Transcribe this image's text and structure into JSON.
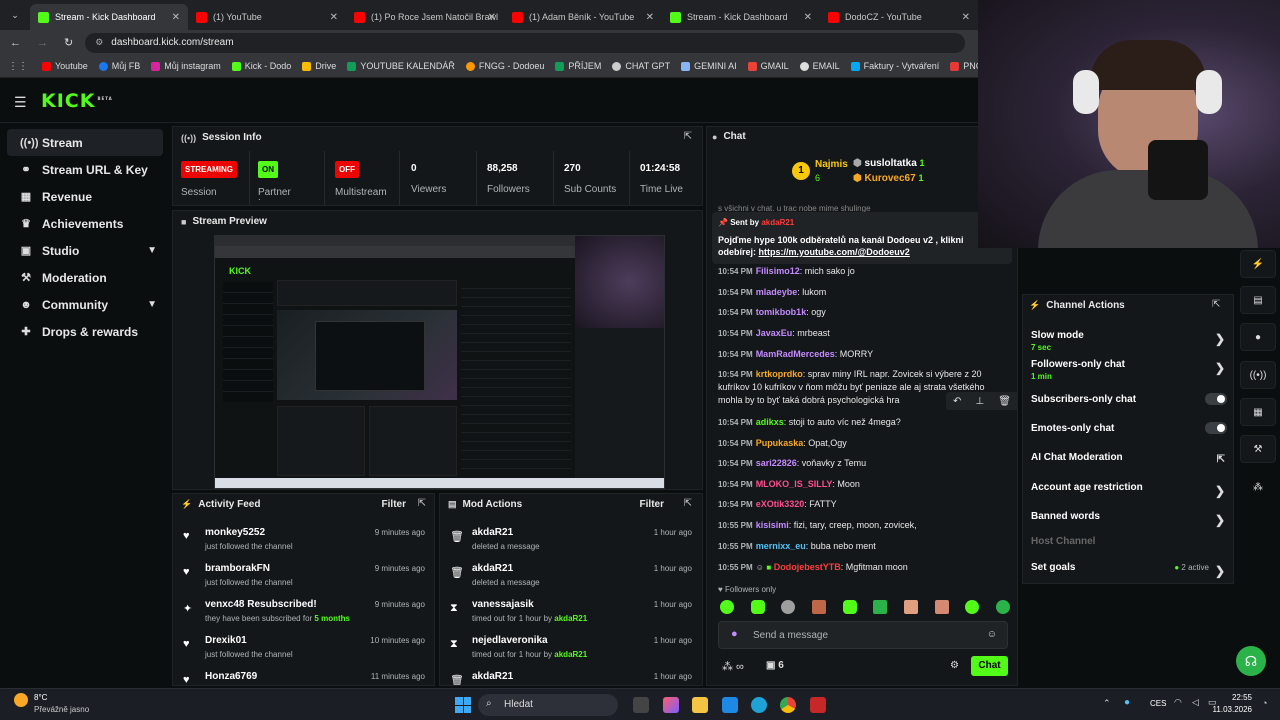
{
  "browser": {
    "tabs": [
      {
        "title": "Stream - Kick Dashboard",
        "icon": "kick",
        "active": true
      },
      {
        "title": "(1) YouTube",
        "icon": "youtube"
      },
      {
        "title": "(1) Po Roce Jsem Natočil Brawl",
        "icon": "youtube"
      },
      {
        "title": "(1) Adam Běník - YouTube",
        "icon": "youtube"
      },
      {
        "title": "Stream - Kick Dashboard",
        "icon": "kick"
      },
      {
        "title": "DodoCZ - YouTube",
        "icon": "youtube"
      }
    ],
    "url": "dashboard.kick.com/stream",
    "bookmarks": [
      "Youtube",
      "Můj FB",
      "Můj instagram",
      "Kick - Dodo",
      "Drive",
      "YOUTUBE KALENDÁŘ",
      "FNGG - Dodoeu",
      "PŘÍJEM",
      "CHAT GPT",
      "GEMINI AI",
      "GMAIL",
      "EMAIL",
      "Faktury - Vytváření",
      "PNG to PDF"
    ]
  },
  "header": {
    "logo": "KICK",
    "beta": "BETA"
  },
  "sidebar": {
    "items": [
      {
        "label": "Stream",
        "icon": "signal-icon",
        "active": true
      },
      {
        "label": "Stream URL & Key",
        "icon": "link-icon"
      },
      {
        "label": "Revenue",
        "icon": "revenue-icon"
      },
      {
        "label": "Achievements",
        "icon": "trophy-icon"
      },
      {
        "label": "Studio",
        "icon": "studio-icon",
        "chevron": true
      },
      {
        "label": "Moderation",
        "icon": "wrench-icon"
      },
      {
        "label": "Community",
        "icon": "people-icon",
        "chevron": true
      },
      {
        "label": "Drops & rewards",
        "icon": "gift-icon"
      }
    ]
  },
  "session": {
    "title": "Session Info",
    "stats": [
      {
        "badge": "STREAMING",
        "badge_color": "#eb0400",
        "label": "Session"
      },
      {
        "badge": "ON",
        "badge_color": "#53fc18",
        "label": "Partner Income"
      },
      {
        "badge": "OFF",
        "badge_color": "#eb0400",
        "label": "Multistream"
      },
      {
        "value": "0",
        "label": "Viewers"
      },
      {
        "value": "88,258",
        "label": "Followers"
      },
      {
        "value": "270",
        "label": "Sub Counts"
      },
      {
        "value": "01:24:58",
        "label": "Time Live"
      }
    ]
  },
  "preview": {
    "title": "Stream Preview"
  },
  "activity": {
    "title": "Activity Feed",
    "filter": "Filter",
    "items": [
      {
        "name": "monkey5252",
        "sub": "just followed the channel",
        "time": "9 minutes ago",
        "icon": "heart-icon"
      },
      {
        "name": "bramborakFN",
        "sub": "just followed the channel",
        "time": "9 minutes ago",
        "icon": "heart-icon"
      },
      {
        "name": "venxc48 Resubscribed!",
        "sub": "they have been subscribed for",
        "sub_em": "5 months",
        "time": "9 minutes ago",
        "icon": "sparkle-icon"
      },
      {
        "name": "Drexik01",
        "sub": "just followed the channel",
        "time": "10 minutes ago",
        "icon": "heart-icon"
      },
      {
        "name": "Honza6769",
        "sub": "",
        "time": "11 minutes ago",
        "icon": "heart-icon"
      }
    ]
  },
  "mod": {
    "title": "Mod Actions",
    "filter": "Filter",
    "items": [
      {
        "name": "akdaR21",
        "sub": "deleted a message",
        "time": "1 hour ago",
        "icon": "trash-icon"
      },
      {
        "name": "akdaR21",
        "sub": "deleted a message",
        "time": "1 hour ago",
        "icon": "trash-icon"
      },
      {
        "name": "vanessajasik",
        "sub": "timed out for 1 hour by",
        "by": "akdaR21",
        "time": "1 hour ago",
        "icon": "hourglass-icon"
      },
      {
        "name": "nejedlaveronika",
        "sub": "timed out for 1 hour by",
        "by": "akdaR21",
        "time": "1 hour ago",
        "icon": "hourglass-icon"
      },
      {
        "name": "akdaR21",
        "sub": "",
        "time": "1 hour ago",
        "icon": "trash-icon"
      }
    ]
  },
  "chat": {
    "title": "Chat",
    "gifters": [
      {
        "rank": "1",
        "name": "Najmis",
        "count": "6"
      },
      {
        "name": "susloltatka",
        "count": "1"
      },
      {
        "name": "Kurovec67",
        "count": "1"
      }
    ],
    "pinned_top": "s všichni v chat. u trac nobe mime shulinge",
    "pinned": {
      "label": "Sent by",
      "user": "akdaR21",
      "text": "Pojďme hype 100k odběratelů na kanál Dodoeu v2 , klikni odebírej:",
      "link": "https://m.youtube.com/@Dodoeuv2"
    },
    "messages": [
      {
        "time": "10:54 PM",
        "user": "Filisimo12",
        "color": "#c58bff",
        "text": "mich sako jo"
      },
      {
        "time": "10:54 PM",
        "user": "mladeybe",
        "color": "#c58bff",
        "text": "lukom"
      },
      {
        "time": "10:54 PM",
        "user": "tomikbob1k",
        "color": "#c58bff",
        "text": "ogy"
      },
      {
        "time": "10:54 PM",
        "user": "JavaxEu",
        "color": "#c58bff",
        "text": "mrbeast"
      },
      {
        "time": "10:54 PM",
        "user": "MamRadMercedes",
        "color": "#c58bff",
        "text": "MORRY"
      },
      {
        "time": "10:54 PM",
        "user": "krtkoprdko",
        "color": "#f9a825",
        "text": "sprav miny IRL napr. Zovicek si výbere z 20 kufríkov 10 kufríkov v ňom môžu byť peniaze ale aj strata všetkého mohla by to byť taká dobrá psychologická hra"
      },
      {
        "time": "10:54 PM",
        "user": "adikxs",
        "color": "#53fc18",
        "text": "stoji to auto víc než 4mega?"
      },
      {
        "time": "10:54 PM",
        "user": "Pupukaska",
        "color": "#f9a825",
        "text": "Opat,Ogy"
      },
      {
        "time": "10:54 PM",
        "user": "sari22826",
        "color": "#c58bff",
        "text": "voňavky z Temu"
      },
      {
        "time": "10:54 PM",
        "user": "MLOKO_IS_SILLY",
        "color": "#ff4d8d",
        "text": "Moon"
      },
      {
        "time": "10:54 PM",
        "user": "eXOtik3320",
        "color": "#ff4d8d",
        "text": "FATTY"
      },
      {
        "time": "10:55 PM",
        "user": "kisisimi",
        "color": "#c58bff",
        "text": "fizi, tary, creep, moon, zovicek,"
      },
      {
        "time": "10:55 PM",
        "user": "mernixx_eu",
        "color": "#4fc3f7",
        "text": "buba nebo ment"
      },
      {
        "time": "10:55 PM",
        "user": "DodojebestYTB",
        "color": "#ff3b3b",
        "text": "Mgfitman moon"
      }
    ],
    "followers_only": "Followers only",
    "placeholder": "Send a message",
    "points": "6",
    "send": "Chat"
  },
  "actions": {
    "title": "Channel Actions",
    "items": [
      {
        "label": "Slow mode",
        "sub": "7 sec",
        "type": "chevron"
      },
      {
        "label": "Followers-only chat",
        "sub": "1 min",
        "type": "chevron"
      },
      {
        "label": "Subscribers-only chat",
        "type": "toggle"
      },
      {
        "label": "Emotes-only chat",
        "type": "toggle"
      },
      {
        "label": "AI Chat Moderation",
        "type": "external"
      },
      {
        "label": "Account age restriction",
        "type": "chevron"
      },
      {
        "label": "Banned words",
        "type": "chevron"
      },
      {
        "label": "Host Channel",
        "type": "disabled"
      },
      {
        "label": "Set goals",
        "sub": "2 active",
        "type": "chevron"
      }
    ]
  },
  "taskbar": {
    "weather_temp": "8°C",
    "weather_desc": "Převážně jasno",
    "search": "Hledat",
    "lang": "CES",
    "time": "22:55",
    "date": "11.03.2026"
  },
  "colors": {
    "accent": "#53fc18",
    "live": "#eb0400",
    "bg": "#0b0e0f",
    "panel": "#141719"
  }
}
